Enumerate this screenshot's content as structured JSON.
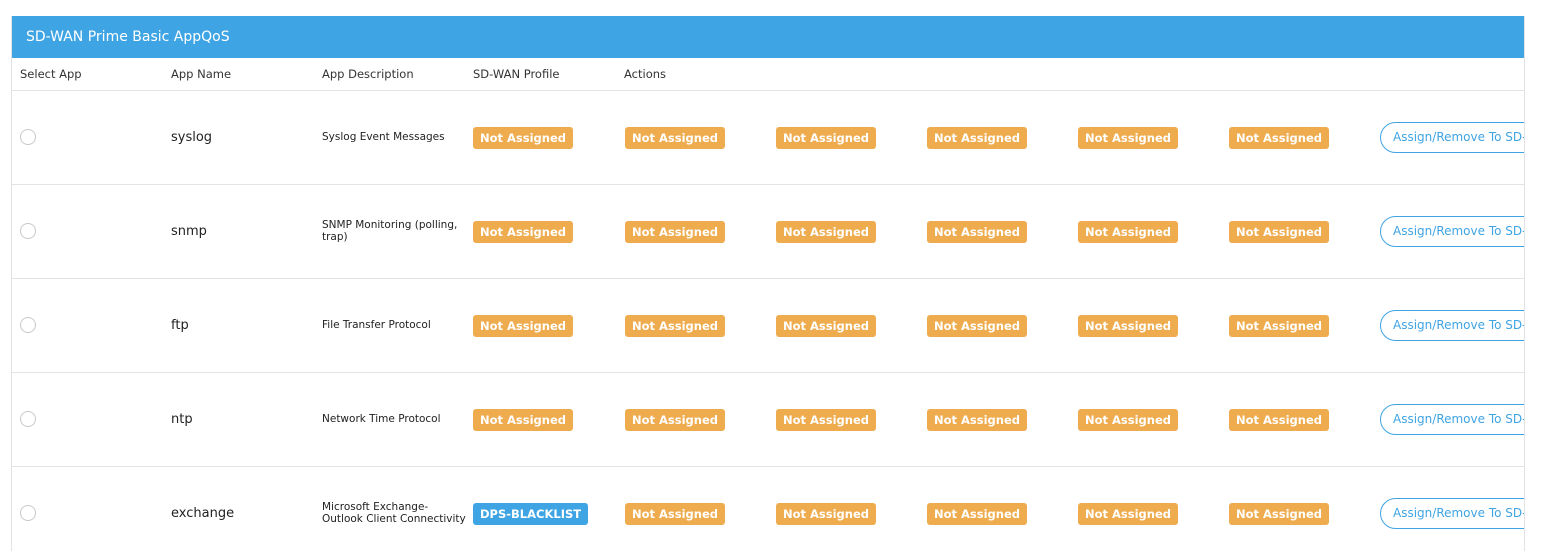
{
  "panel": {
    "title": "SD-WAN Prime Basic AppQoS"
  },
  "columns": {
    "select_app": "Select App",
    "app_name": "App Name",
    "app_description": "App Description",
    "sdwan_profile": "SD-WAN Profile",
    "actions": "Actions"
  },
  "colors": {
    "header_blue": "#3fa4e3",
    "not_assigned_orange": "#eeac4f",
    "assigned_blue": "#3fa4e3"
  },
  "rows": [
    {
      "name": "syslog",
      "description": "Syslog Event Messages",
      "profiles": [
        "Not Assigned",
        "Not Assigned",
        "Not Assigned",
        "Not Assigned",
        "Not Assigned",
        "Not Assigned"
      ],
      "action_label": "Assign/Remove To SD-WAN"
    },
    {
      "name": "snmp",
      "description": "SNMP Monitoring (polling, trap)",
      "profiles": [
        "Not Assigned",
        "Not Assigned",
        "Not Assigned",
        "Not Assigned",
        "Not Assigned",
        "Not Assigned"
      ],
      "action_label": "Assign/Remove To SD-WAN"
    },
    {
      "name": "ftp",
      "description": "File Transfer Protocol",
      "profiles": [
        "Not Assigned",
        "Not Assigned",
        "Not Assigned",
        "Not Assigned",
        "Not Assigned",
        "Not Assigned"
      ],
      "action_label": "Assign/Remove To SD-WAN"
    },
    {
      "name": "ntp",
      "description": "Network Time Protocol",
      "profiles": [
        "Not Assigned",
        "Not Assigned",
        "Not Assigned",
        "Not Assigned",
        "Not Assigned",
        "Not Assigned"
      ],
      "action_label": "Assign/Remove To SD-WAN"
    },
    {
      "name": "exchange",
      "description": "Microsoft Exchange-Outlook Client Connectivity",
      "profiles": [
        "DPS-BLACKLIST",
        "Not Assigned",
        "Not Assigned",
        "Not Assigned",
        "Not Assigned",
        "Not Assigned"
      ],
      "action_label": "Assign/Remove To SD-WAN"
    }
  ]
}
